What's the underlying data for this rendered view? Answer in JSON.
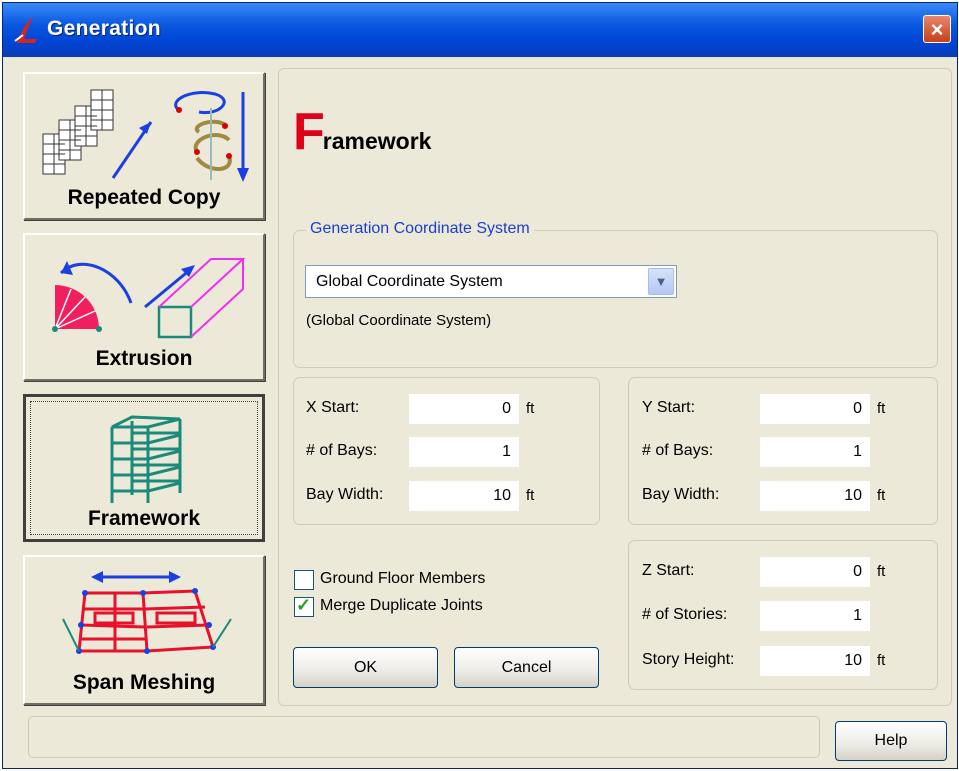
{
  "window": {
    "title": "Generation",
    "close_icon": "×"
  },
  "sidebar": {
    "items": [
      {
        "label": "Repeated Copy",
        "icon": "repeated-copy-icon"
      },
      {
        "label": "Extrusion",
        "icon": "extrusion-icon"
      },
      {
        "label": "Framework",
        "icon": "framework-icon",
        "active": true
      },
      {
        "label": "Span Meshing",
        "icon": "span-meshing-icon"
      }
    ]
  },
  "page": {
    "title_first_letter": "F",
    "title_rest": "ramework",
    "accent_color": "#e0001a"
  },
  "coord_system": {
    "group_title": "Generation Coordinate System",
    "selected": "Global Coordinate System",
    "note": "(Global Coordinate System)"
  },
  "x_group": {
    "start_label": "X Start:",
    "start_value": "0",
    "start_unit": "ft",
    "bays_label": "# of Bays:",
    "bays_value": "1",
    "width_label": "Bay Width:",
    "width_value": "10",
    "width_unit": "ft"
  },
  "y_group": {
    "start_label": "Y Start:",
    "start_value": "0",
    "start_unit": "ft",
    "bays_label": "# of Bays:",
    "bays_value": "1",
    "width_label": "Bay Width:",
    "width_value": "10",
    "width_unit": "ft"
  },
  "z_group": {
    "start_label": "Z Start:",
    "start_value": "0",
    "start_unit": "ft",
    "stories_label": "# of Stories:",
    "stories_value": "1",
    "height_label": "Story Height:",
    "height_value": "10",
    "height_unit": "ft"
  },
  "options": {
    "ground_floor_label": "Ground Floor Members",
    "ground_floor_checked": false,
    "merge_label": "Merge Duplicate Joints",
    "merge_checked": true
  },
  "buttons": {
    "ok": "OK",
    "cancel": "Cancel",
    "help": "Help"
  }
}
